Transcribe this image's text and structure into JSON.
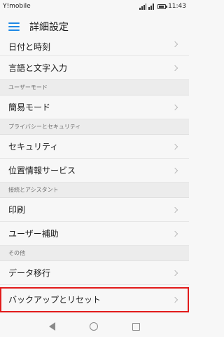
{
  "status_bar": {
    "carrier": "Y!mobile",
    "time": "11:43"
  },
  "app_bar": {
    "title": "詳細設定"
  },
  "items": {
    "date_time": "日付と時刻",
    "language_input": "言語と文字入力",
    "section_user_mode": "ユーザーモード",
    "easy_mode": "簡易モード",
    "section_privacy_security": "プライバシーとセキュリティ",
    "security": "セキュリティ",
    "location_services": "位置情報サービス",
    "section_connection_assistant": "接続とアシスタント",
    "print": "印刷",
    "user_assist": "ユーザー補助",
    "section_other": "その他",
    "data_migration": "データ移行",
    "backup_reset": "バックアップとリセット"
  },
  "colors": {
    "accent": "#1e88e5",
    "highlight": "#e21b1b"
  }
}
